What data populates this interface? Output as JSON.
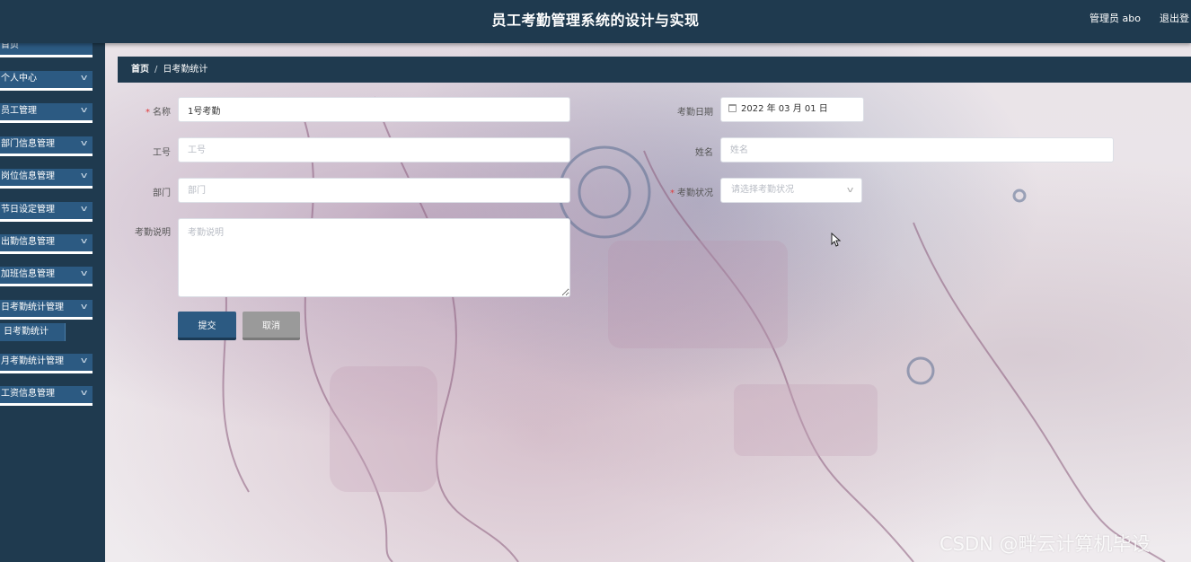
{
  "header": {
    "title": "员工考勤管理系统的设计与实现",
    "user": "管理员 abo",
    "logout": "退出登"
  },
  "sidebar": {
    "items": [
      {
        "label": "首页",
        "has_chevron": false
      },
      {
        "label": "个人中心",
        "has_chevron": true
      },
      {
        "label": "员工管理",
        "has_chevron": true
      },
      {
        "label": "部门信息管理",
        "has_chevron": true
      },
      {
        "label": "岗位信息管理",
        "has_chevron": true
      },
      {
        "label": "节日设定管理",
        "has_chevron": true
      },
      {
        "label": "出勤信息管理",
        "has_chevron": true
      },
      {
        "label": "加班信息管理",
        "has_chevron": true
      },
      {
        "label": "日考勤统计管理",
        "has_chevron": true
      },
      {
        "label": "月考勤统计管理",
        "has_chevron": true
      },
      {
        "label": "工资信息管理",
        "has_chevron": true
      }
    ],
    "submenu": {
      "label": "日考勤统计",
      "parent": "日考勤统计管理"
    }
  },
  "breadcrumb": {
    "home": "首页",
    "separator": "/",
    "current": "日考勤统计"
  },
  "form": {
    "name": {
      "label": "名称",
      "required": true,
      "value": "1号考勤"
    },
    "date": {
      "label": "考勤日期",
      "value": "2022 年 03 月 01 日"
    },
    "employee_no": {
      "label": "工号",
      "placeholder": "工号"
    },
    "employee_name": {
      "label": "姓名",
      "placeholder": "姓名"
    },
    "department": {
      "label": "部门",
      "placeholder": "部门"
    },
    "status": {
      "label": "考勤状况",
      "required": true,
      "placeholder": "请选择考勤状况"
    },
    "note": {
      "label": "考勤说明",
      "placeholder": "考勤说明"
    },
    "submit": "提交",
    "cancel": "取消"
  },
  "icons": {
    "chevron": "chevron-down-icon",
    "calendar": "calendar-icon",
    "cursor": "mouse-cursor-icon"
  },
  "colors": {
    "header_bg": "#1f3a4f",
    "menu_bg": "#2c5a82",
    "submit_bg": "#2c5a82",
    "cancel_bg": "#9a9a9a",
    "required": "#e03a3a"
  },
  "watermark": "CSDN @畔云计算机毕设"
}
